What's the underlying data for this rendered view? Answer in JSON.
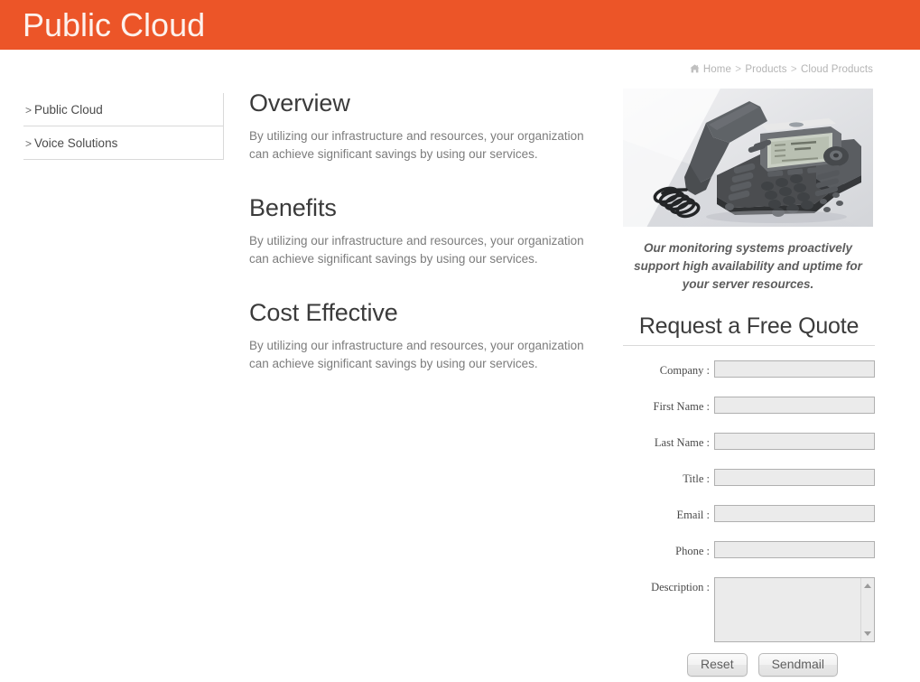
{
  "header": {
    "title": "Public Cloud",
    "background_color": "#ec5528",
    "title_color": "#fdf1ec"
  },
  "breadcrumb": {
    "home_icon": "home-icon",
    "items": [
      "Home",
      "Products",
      "Cloud Products"
    ],
    "separator": ">"
  },
  "sidebar": {
    "arrow": ">",
    "items": [
      {
        "label": "Public Cloud"
      },
      {
        "label": "Voice Solutions"
      }
    ]
  },
  "main": {
    "sections": [
      {
        "title": "Overview",
        "body": "By utilizing our infrastructure and resources, your organization can achieve significant savings by using our services."
      },
      {
        "title": "Benefits",
        "body": "By utilizing our infrastructure and resources, your organization can achieve significant savings by using our services."
      },
      {
        "title": "Cost Effective",
        "body": "By utilizing our infrastructure and resources, your organization can achieve significant savings by using our services."
      }
    ]
  },
  "right_column": {
    "product_image_alt": "voip-desk-phone-image",
    "caption": "Our monitoring systems proactively support high availability and uptime for your server resources.",
    "quote_heading": "Request a Free Quote",
    "form": {
      "fields": [
        {
          "label": "Company :",
          "value": "",
          "type": "text",
          "name": "company-field"
        },
        {
          "label": "First Name :",
          "value": "",
          "type": "text",
          "name": "first-name-field"
        },
        {
          "label": "Last Name :",
          "value": "",
          "type": "text",
          "name": "last-name-field"
        },
        {
          "label": "Title :",
          "value": "",
          "type": "text",
          "name": "title-field"
        },
        {
          "label": "Email :",
          "value": "",
          "type": "text",
          "name": "email-field"
        },
        {
          "label": "Phone :",
          "value": "",
          "type": "text",
          "name": "phone-field"
        }
      ],
      "description": {
        "label": "Description :",
        "value": ""
      },
      "buttons": {
        "reset": "Reset",
        "sendmail": "Sendmail"
      }
    }
  }
}
